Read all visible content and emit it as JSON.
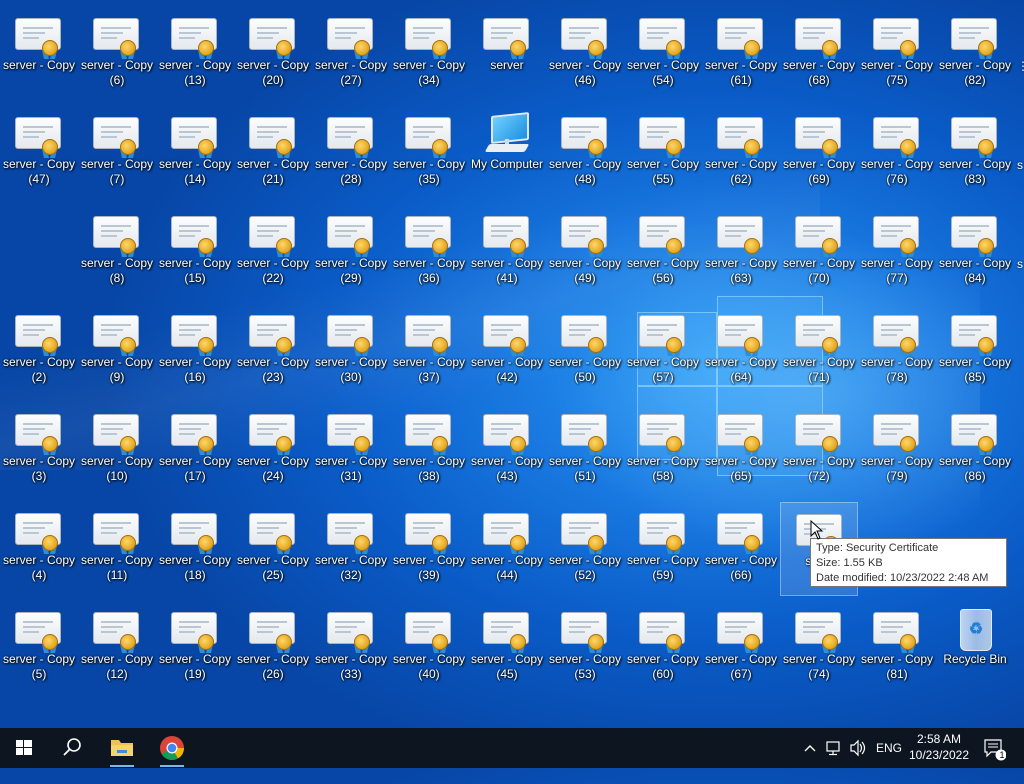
{
  "desktop": {
    "columns": [
      [
        "server - Copy",
        "server - Copy\n(47)",
        "",
        "server - Copy\n(2)",
        "server - Copy\n(3)",
        "server - Copy\n(4)",
        "server - Copy\n(5)"
      ],
      [
        "server - Copy\n(6)",
        "server - Copy\n(7)",
        "server - Copy\n(8)",
        "server - Copy\n(9)",
        "server - Copy\n(10)",
        "server - Copy\n(11)",
        "server - Copy\n(12)"
      ],
      [
        "server - Copy\n(13)",
        "server - Copy\n(14)",
        "server - Copy\n(15)",
        "server - Copy\n(16)",
        "server - Copy\n(17)",
        "server - Copy\n(18)",
        "server - Copy\n(19)"
      ],
      [
        "server - Copy\n(20)",
        "server - Copy\n(21)",
        "server - Copy\n(22)",
        "server - Copy\n(23)",
        "server - Copy\n(24)",
        "server - Copy\n(25)",
        "server - Copy\n(26)"
      ],
      [
        "server - Copy\n(27)",
        "server - Copy\n(28)",
        "server - Copy\n(29)",
        "server - Copy\n(30)",
        "server - Copy\n(31)",
        "server - Copy\n(32)",
        "server - Copy\n(33)"
      ],
      [
        "server - Copy\n(34)",
        "server - Copy\n(35)",
        "server - Copy\n(36)",
        "server - Copy\n(37)",
        "server - Copy\n(38)",
        "server - Copy\n(39)",
        "server - Copy\n(40)"
      ],
      [
        "server",
        "My Computer",
        "server - Copy\n(41)",
        "server - Copy\n(42)",
        "server - Copy\n(43)",
        "server - Copy\n(44)",
        "server - Copy\n(45)"
      ],
      [
        "server - Copy\n(46)",
        "server - Copy\n(48)",
        "server - Copy\n(49)",
        "server - Copy\n(50)",
        "server - Copy\n(51)",
        "server - Copy\n(52)",
        "server - Copy\n(53)"
      ],
      [
        "server - Copy\n(54)",
        "server - Copy\n(55)",
        "server - Copy\n(56)",
        "server - Copy\n(57)",
        "server - Copy\n(58)",
        "server - Copy\n(59)",
        "server - Copy\n(60)"
      ],
      [
        "server - Copy\n(61)",
        "server - Copy\n(62)",
        "server - Copy\n(63)",
        "server - Copy\n(64)",
        "server - Copy\n(65)",
        "server - Copy\n(66)",
        "server - Copy\n(67)"
      ],
      [
        "server - Copy\n(68)",
        "server - Copy\n(69)",
        "server - Copy\n(70)",
        "server - Copy\n(71)",
        "server - Copy\n(72)",
        "serve",
        "server - Copy\n(74)"
      ],
      [
        "server - Copy\n(75)",
        "server - Copy\n(76)",
        "server - Copy\n(77)",
        "server - Copy\n(78)",
        "server - Copy\n(79)",
        "",
        "server - Copy\n(81)"
      ],
      [
        "server - Copy\n(82)",
        "server - Copy\n(83)",
        "server - Copy\n(84)",
        "server - Copy\n(85)",
        "server - Copy\n(86)",
        "",
        "Recycle Bin"
      ]
    ],
    "special_icons": {
      "My Computer": "computer-icon",
      "Recycle Bin": "recycle-bin-icon"
    },
    "hidden_cells": [
      "0-2",
      "11-5",
      "12-5"
    ],
    "hovered_cell": "10-5",
    "edge_fragments": [
      "s",
      "s"
    ]
  },
  "tooltip": {
    "type_line": "Type: Security Certificate",
    "size_line": "Size: 1.55 KB",
    "date_line": "Date modified: 10/23/2022 2:48 AM"
  },
  "taskbar": {
    "start_icon": "windows-logo-icon",
    "search_icon": "search-icon",
    "pinned": [
      "file-explorer-icon",
      "chrome-icon"
    ],
    "tray_lang": "ENG",
    "clock_time": "2:58 AM",
    "clock_date": "10/23/2022",
    "notification_count": "1",
    "colors": {
      "taskbar": "#0c1520",
      "active_underline": "#76b9ed"
    }
  }
}
